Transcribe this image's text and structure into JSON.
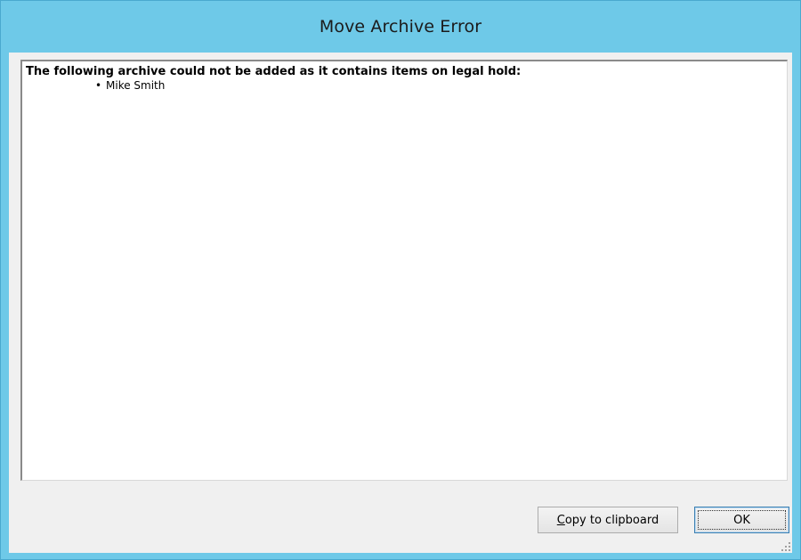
{
  "window": {
    "title": "Move Archive Error"
  },
  "message": {
    "heading": "The following archive could not be added as it contains items on legal hold:",
    "items": [
      "Mike Smith"
    ]
  },
  "buttons": {
    "copy_label": "Copy to clipboard",
    "ok_label": "OK"
  },
  "icons": {
    "bullet": "bullet-icon",
    "resize_grip": "resize-grip-icon"
  },
  "colors": {
    "titlebar": "#6ec9e8",
    "dialog_background": "#f0f0f0",
    "message_background": "#ffffff"
  }
}
